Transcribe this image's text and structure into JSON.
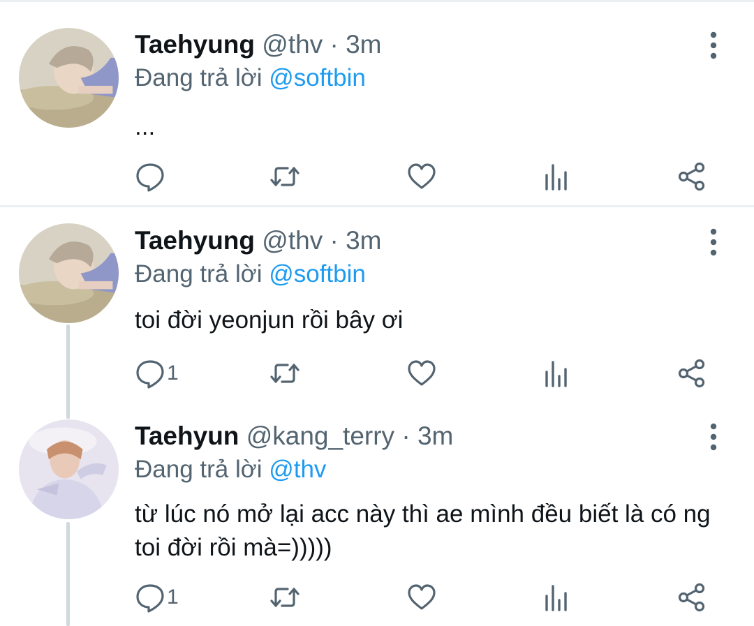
{
  "tweets": [
    {
      "name": "Taehyung",
      "handle": "@thv",
      "dot": "·",
      "time": "3m",
      "reply_prefix": "Đang trả lời",
      "reply_mention": "@softbin",
      "text": "...",
      "reply_count": "",
      "avatar_icon": "person-photo-avatar"
    },
    {
      "name": "Taehyung",
      "handle": "@thv",
      "dot": "·",
      "time": "3m",
      "reply_prefix": "Đang trả lời",
      "reply_mention": "@softbin",
      "text": "toi đời yeonjun rồi bây ơi",
      "reply_count": "1",
      "avatar_icon": "person-photo-avatar"
    },
    {
      "name": "Taehyun",
      "handle": "@kang_terry",
      "dot": "·",
      "time": "3m",
      "reply_prefix": "Đang trả lời",
      "reply_mention": "@thv",
      "text": "từ lúc nó mở lại acc này thì ae mình đều biết là có ng toi đời rồi mà=)))))",
      "reply_count": "1",
      "avatar_icon": "person-photo-avatar"
    }
  ],
  "icons": [
    "reply-icon",
    "retweet-icon",
    "like-icon",
    "views-icon",
    "share-icon",
    "more-options-icon"
  ],
  "colors": {
    "mention": "#1d9bf0",
    "meta": "#536471",
    "text": "#0f1419",
    "thread_line": "#cfd9de"
  }
}
